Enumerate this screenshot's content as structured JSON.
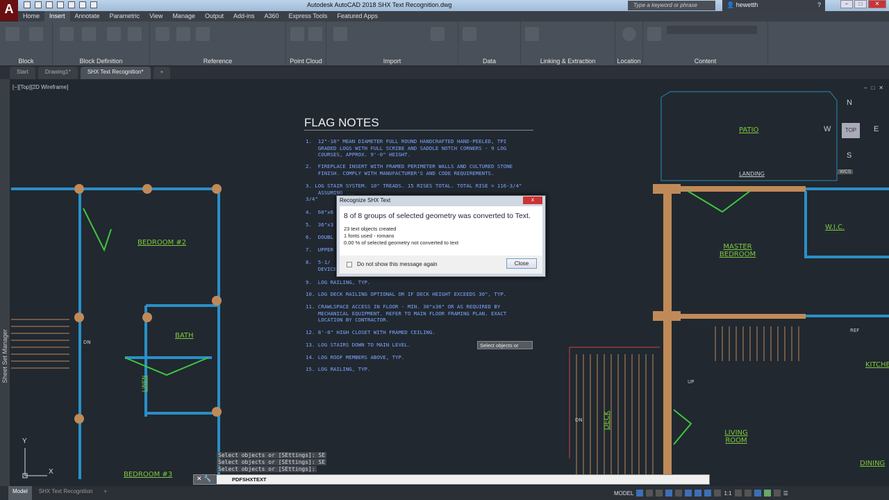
{
  "titlebar": {
    "app_letter": "A",
    "title": "Autodesk AutoCAD 2018   SHX Text Recognition.dwg",
    "search_placeholder": "Type a keyword or phrase",
    "user": "hewetth"
  },
  "ribbon_tabs": [
    "Home",
    "Insert",
    "Annotate",
    "Parametric",
    "View",
    "Manage",
    "Output",
    "Add-ins",
    "A360",
    "Express Tools",
    "Featured Apps"
  ],
  "ribbon_panels": [
    "Block",
    "Block Definition",
    "Reference",
    "Point Cloud",
    "Import",
    "Data",
    "Linking & Extraction",
    "Location",
    "Content"
  ],
  "doc_tabs": [
    "Start",
    "Drawing1*",
    "SHX Text Recognition*"
  ],
  "viewport_label": "[−][Top][2D Wireframe]",
  "sheet_set_manager": "Sheet Set Manager",
  "flag_notes": {
    "title": "FLAG NOTES",
    "notes": [
      "1.  12\"-16\" MEAN DIAMETER FULL ROUND HANDCRAFTED HAND-PEELED, TPI\n    GRADED LOGS WITH FULL SCRIBE AND SADDLE NOTCH CORNERS - 9 LOG\n    COURSES, APPROX. 9'-0\" HEIGHT.",
      "2.  FIREPLACE INSERT WITH FRAMED PERIMETER WALLS AND CULTURED STONE\n    FINISH. COMPLY WITH MANUFACTURER'S AND CODE REQUIREMENTS.",
      "3. LOG STAIR SYSTEM. 10\" TREADS. 15 RISES TOTAL. TOTAL RISE = 116-3/4\"\n    ASSUMING ...\n3/4\"",
      "4.  60\"x6",
      "5.  36\"x3",
      "6.  DOUBL",
      "7.  UPPER",
      "8.  5-1/\n    DEVICE",
      "9.  LOG RAILING, TYP.",
      "10. LOG DECK RAILING OPTIONAL OR IF DECK HEIGHT EXCEEDS 30\", TYP.",
      "11. CRAWLSPACE ACCESS IN FLOOR - MIN. 30\"x30\" OR AS REQUIRED BY\n    MECHANICAL EQUIPMENT. REFER TO MAIN FLOOR FRAMING PLAN. EXACT\n    LOCATION BY CONTRACTOR.",
      "12. 8'-0\" HIGH CLOSET WITH FRAMED CEILING.",
      "13. LOG STAIRS DOWN TO MAIN LEVEL.",
      "14. LOG ROOF MEMBERS ABOVE, TYP.",
      "15. LOG RAILING, TYP."
    ]
  },
  "dialog": {
    "title": "Recognize SHX Text",
    "close_x": "x",
    "message": "8 of 8 groups of selected geometry was converted to Text.",
    "details": [
      "23 text objects created",
      "1 fonts used  - romans",
      "0.00 % of selected geometry not converted to text"
    ],
    "checkbox_label": "Do not show this message again",
    "close_button": "Close"
  },
  "tooltip": "Select objects or",
  "rooms": [
    "BEDROOM #2",
    "BATH",
    "LINEN",
    "BEDROOM #3",
    "PATIO",
    "LANDING",
    "MASTER BEDROOM",
    "W.I.C.",
    "DECK",
    "LIVING ROOM",
    "DINING",
    "KITCHEN",
    "REF",
    "UP",
    "DN",
    "DN"
  ],
  "command": {
    "history": [
      "Select objects or [SEttings]: SE",
      "Select objects or [SEttings]: SE",
      "Select objects or [SEttings]:"
    ],
    "current": "PDFSHXTEXT"
  },
  "layout_tabs": [
    "Model",
    "SHX Text Recognition",
    "+"
  ],
  "status": {
    "model": "MODEL",
    "scale": "1:1"
  },
  "viewcube": {
    "n": "N",
    "s": "S",
    "e": "E",
    "w": "W",
    "top": "TOP",
    "wcs": "WCS"
  },
  "ucs": {
    "x": "X",
    "y": "Y"
  }
}
